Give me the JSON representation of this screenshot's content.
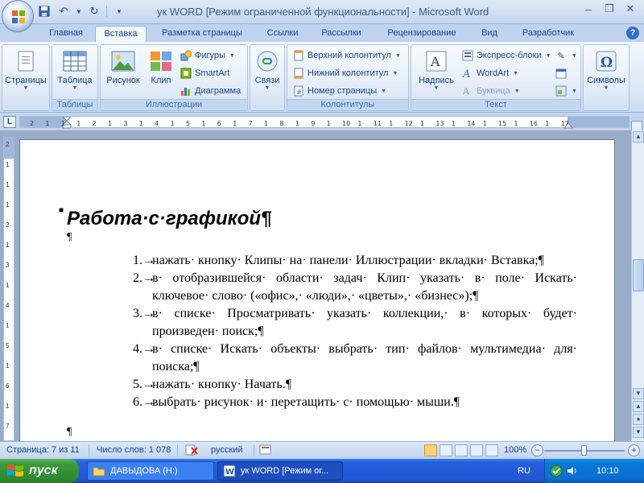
{
  "window": {
    "title": "ук WORD [Режим ограниченной функциональности] - Microsoft Word"
  },
  "tabs": [
    {
      "label": "Главная"
    },
    {
      "label": "Вставка"
    },
    {
      "label": "Разметка страницы"
    },
    {
      "label": "Ссылки"
    },
    {
      "label": "Рассылки"
    },
    {
      "label": "Рецензирование"
    },
    {
      "label": "Вид"
    },
    {
      "label": "Разработчик"
    }
  ],
  "ribbon": {
    "pages": {
      "label": "Страницы",
      "group": ""
    },
    "tables": {
      "label": "Таблица",
      "group": "Таблицы"
    },
    "illustrations": {
      "group": "Иллюстрации",
      "picture": "Рисунок",
      "clip": "Клип",
      "shapes": "Фигуры",
      "smartart": "SmartArt",
      "chart": "Диаграмма"
    },
    "links": {
      "label": "Связи"
    },
    "headers": {
      "group": "Колонтитулы",
      "header": "Верхний колонтитул",
      "footer": "Нижний колонтитул",
      "page_number": "Номер страницы"
    },
    "text": {
      "group": "Текст",
      "textbox": "Надпись",
      "quickparts": "Экспресс-блоки",
      "wordart": "WordArt",
      "dropcap": "Буквица"
    },
    "symbols": {
      "label": "Символы"
    }
  },
  "ruler": {
    "ticks": [
      "2",
      "1",
      "1",
      "1",
      "2",
      "1",
      "3",
      "1",
      "4",
      "1",
      "5",
      "1",
      "6",
      "1",
      "7",
      "1",
      "8",
      "1",
      "9",
      "1",
      "10",
      "1",
      "11",
      "1",
      "12",
      "1",
      "13",
      "1",
      "14",
      "1",
      "15",
      "1",
      "16",
      "1",
      "17"
    ],
    "vticks": [
      "2",
      "1",
      "1",
      "1",
      "2",
      "1",
      "3",
      "1",
      "4",
      "1",
      "5",
      "1",
      "6",
      "1",
      "7"
    ]
  },
  "document": {
    "title": "Работа·с·графикой¶",
    "empty_mark": "¶",
    "items": [
      {
        "num": "1.→",
        "text": "нажать· кнопку· Клипы· на· панели· Иллюстрации· вкладки· Вставка;¶"
      },
      {
        "num": "2.→",
        "text": "в· отобразившейся· области· задач· Клип· указать· в· поле· Искать· ключевое· слово· («офис»,· «люди»,· «цветы»,· «бизнес»);¶"
      },
      {
        "num": "3.→",
        "text": "в· списке· Просматривать· указать· коллекции,· в· которых· будет· произведен· поиск;¶"
      },
      {
        "num": "4.→",
        "text": "в· списке· Искать· объекты· выбрать· тип· файлов· мультимедиа· для· поиска;¶"
      },
      {
        "num": "5.→",
        "text": "нажать· кнопку· Начать.¶"
      },
      {
        "num": "6.→",
        "text": "выбрать· рисунок· и· перетащить· с· помощью· мыши.¶"
      }
    ]
  },
  "status": {
    "page": "Страница: 7 из 11",
    "words": "Число слов: 1 078",
    "language": "русский",
    "zoom": "100%"
  },
  "taskbar": {
    "start": "пуск",
    "task1": "ДАВЫДОВА (H:)",
    "task2": "ук WORD [Режим ог...",
    "lang": "RU",
    "time": "10:10"
  }
}
